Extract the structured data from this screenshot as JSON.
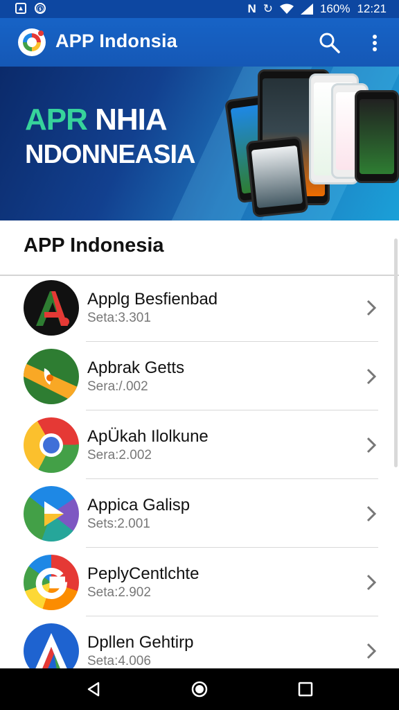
{
  "status_bar": {
    "battery_text": "160%",
    "time": "12:21"
  },
  "app_bar": {
    "title": "APP Indonsia",
    "search_icon": "search-icon",
    "menu_icon": "more-vert-icon"
  },
  "banner": {
    "line1_part1": "APR",
    "line1_part2": " NHIA",
    "line2": "NDONNEASIA"
  },
  "section": {
    "title": "APP Indonesia"
  },
  "apps": [
    {
      "name": "Applg Besfienbad",
      "sub": "Seta:3.301",
      "icon": "red-a-app-icon"
    },
    {
      "name": "Apbrak Getts",
      "sub": "Sera:/.002",
      "icon": "green-orange-app-icon"
    },
    {
      "name": "ApÜkah Ilolkune",
      "sub": "Sera:2.002",
      "icon": "chrome-like-app-icon"
    },
    {
      "name": "Appica Galisp",
      "sub": "Sets:2.001",
      "icon": "play-like-app-icon"
    },
    {
      "name": "PeplyCentlchte",
      "sub": "Seta:2.902",
      "icon": "colorful-g-app-icon"
    },
    {
      "name": "Dpllen Gehtirp",
      "sub": "Seta:4.006",
      "icon": "blue-a-app-icon"
    }
  ],
  "nav": {
    "back": "back-icon",
    "home": "home-icon",
    "recents": "recents-icon"
  },
  "colors": {
    "app_bar": "#1763c6",
    "status_bar": "#0d47a1",
    "banner_accent": "#37d39b"
  }
}
